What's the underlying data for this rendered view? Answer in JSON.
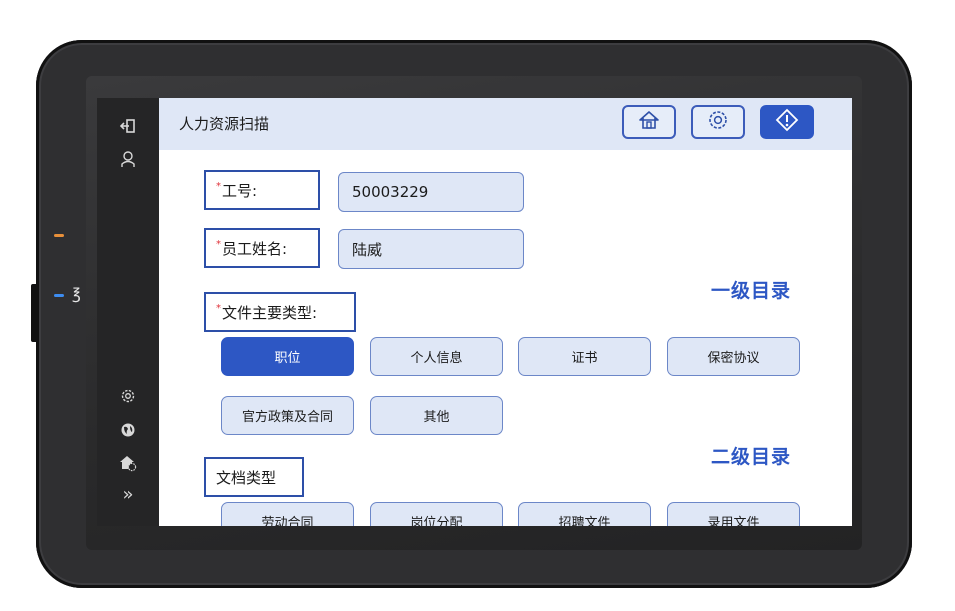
{
  "app": {
    "title": "人力资源扫描"
  },
  "toolbar": {
    "home_icon": "home-icon",
    "settings_icon": "gear-icon",
    "start_icon": "diamond-start-icon"
  },
  "left_rail": {
    "top_icons": [
      "logout-icon",
      "user-icon"
    ],
    "bottom_icons": [
      "gear-icon",
      "globe-icon",
      "home-settings-icon",
      "expand-icon"
    ],
    "expand_glyph": "»"
  },
  "form": {
    "employee_id": {
      "label": "工号:",
      "value": "50003229",
      "required_mark": "*"
    },
    "employee_name": {
      "label": "员工姓名:",
      "value": "陆威",
      "required_mark": "*"
    }
  },
  "primary_section": {
    "heading": "一级目录",
    "label": "文件主要类型:",
    "required_mark": "*",
    "options": [
      "职位",
      "个人信息",
      "证书",
      "保密协议",
      "官方政策及合同",
      "其他"
    ],
    "selected": "职位"
  },
  "secondary_section": {
    "heading": "二级目录",
    "label": "文档类型",
    "options": [
      "劳动合同",
      "岗位分配",
      "招聘文件",
      "录用文件"
    ]
  },
  "colors": {
    "accent": "#2d57c4",
    "chip_bg": "#dfe7f6",
    "required": "#e0333b",
    "orange_led": "#e8903a",
    "blue_led": "#3d8cf0"
  }
}
